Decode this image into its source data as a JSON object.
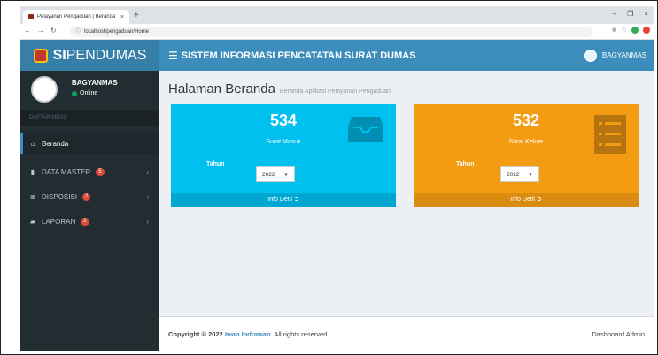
{
  "browser": {
    "tab_title": "Pelayanan Pengaduan | Beranda",
    "tab_close": "×",
    "new_tab": "+",
    "url": "localhost/pengaduan/Home",
    "window_controls": [
      "–",
      "❐",
      "×"
    ]
  },
  "app": {
    "logo_bold": "SI",
    "logo_rest": "PENDUMAS",
    "header_title": "SISTEM INFORMASI PENCATATAN SURAT DUMAS",
    "user_name": "BAGYANMAS"
  },
  "sidebar": {
    "user_name": "BAGYANMAS",
    "status": "Online",
    "menu_header": "DAFTAR MENU",
    "items": [
      {
        "label": "Beranda",
        "icon": "home-icon",
        "badge": null
      },
      {
        "label": "DATA MASTER",
        "icon": "file-icon",
        "badge": "5"
      },
      {
        "label": "DISPOSISI",
        "icon": "list-icon",
        "badge": "2"
      },
      {
        "label": "LAPORAN",
        "icon": "book-icon",
        "badge": "2"
      }
    ]
  },
  "content": {
    "title": "Halaman Beranda",
    "subtitle": "Beranda Aplikasi Pelayanan Pengaduan",
    "boxes": [
      {
        "number": "534",
        "label": "Surat Masuk",
        "year_label": "Tahun",
        "year": "2022",
        "footer": "Info Detil",
        "color": "#00c0ef"
      },
      {
        "number": "532",
        "label": "Surat Keluar",
        "year_label": "Tahun",
        "year": "2022",
        "footer": "Info Detil",
        "color": "#f39c12"
      }
    ]
  },
  "footer": {
    "copyright_prefix": "Copyright © 2022",
    "author": "Iwan Indrawan",
    "rights": ". All rights reserved.",
    "right_text": "Dashboard Admin"
  }
}
